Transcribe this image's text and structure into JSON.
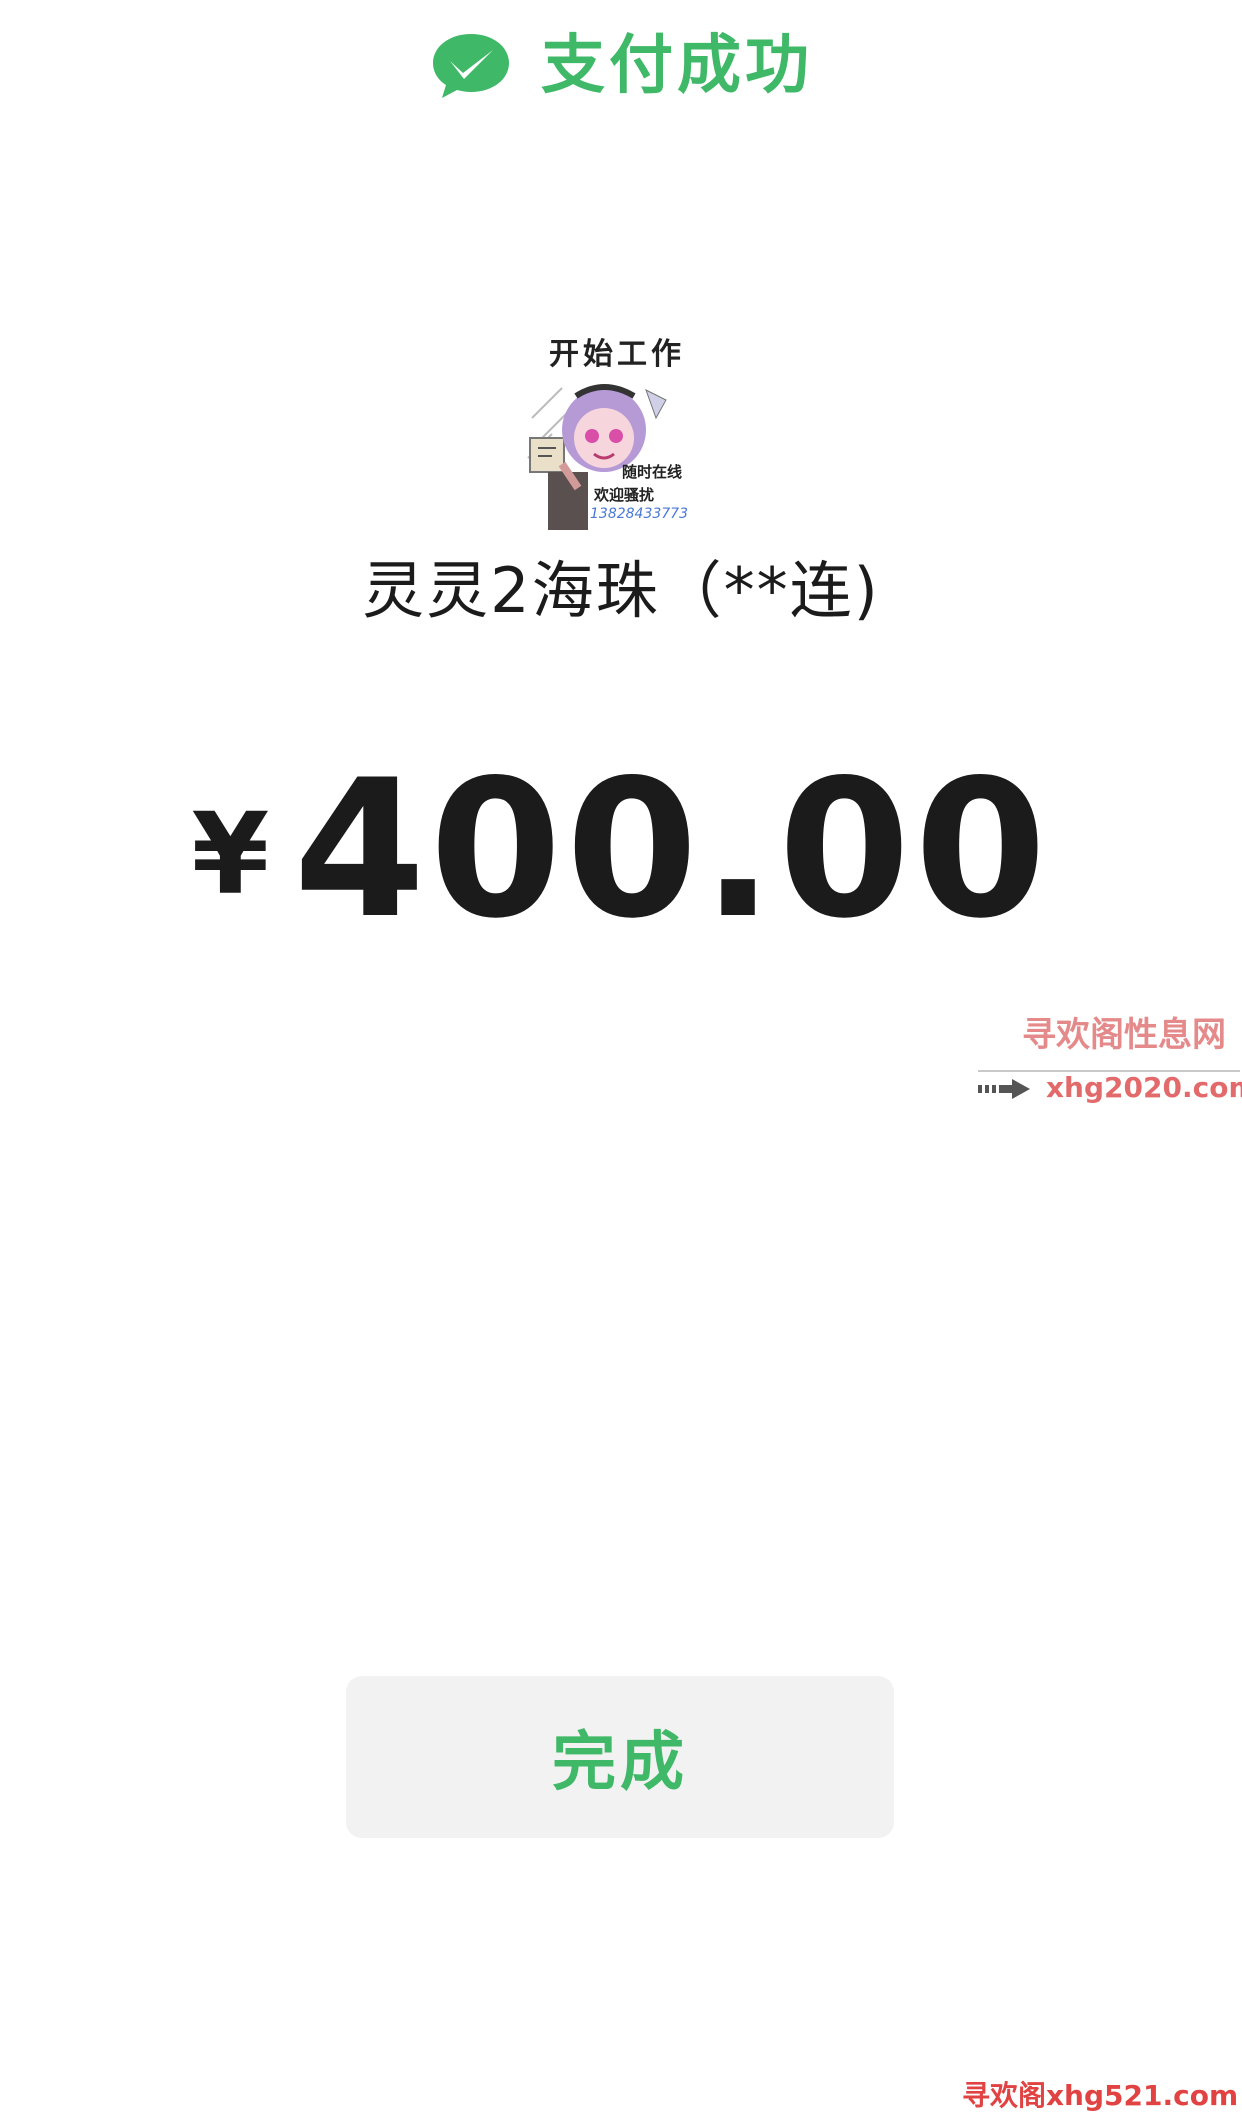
{
  "header": {
    "icon": "wechat-pay-icon",
    "title": "支付成功"
  },
  "avatar": {
    "caption": "开始工作",
    "line1": "随时在线",
    "line2": "欢迎骚扰",
    "phone": "13828433773"
  },
  "merchant": {
    "name": "灵灵2海珠（**连)"
  },
  "payment": {
    "currency": "¥",
    "amount": "400.00"
  },
  "actions": {
    "done_label": "完成"
  },
  "watermark": {
    "site_name": "寻欢阁性息网",
    "site_url": "xhg2020.com",
    "footer": "寻欢阁xhg521.com"
  },
  "colors": {
    "accent_green": "#3fb867",
    "text_dark": "#1b1b1b",
    "button_bg": "#f2f2f2",
    "watermark_red": "#e14343"
  }
}
